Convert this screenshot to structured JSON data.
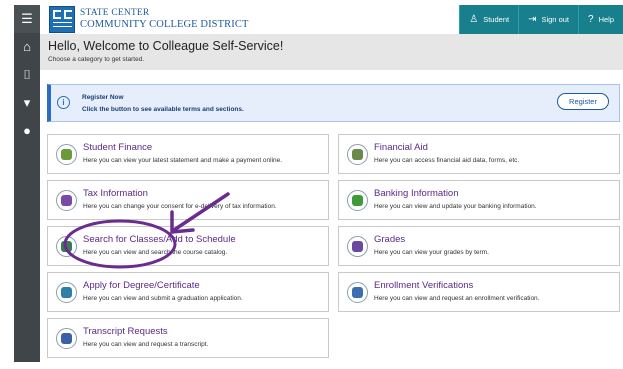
{
  "rail": {
    "items": [
      {
        "icon": "menu-icon",
        "glyph": "☰"
      },
      {
        "icon": "home-icon",
        "glyph": "⌂"
      },
      {
        "icon": "bank-icon",
        "glyph": "⌷"
      },
      {
        "icon": "graduation-cap-icon",
        "glyph": "▾"
      },
      {
        "icon": "person-icon",
        "glyph": "●"
      }
    ]
  },
  "header": {
    "school_line1": "STATE CENTER",
    "school_line2": "COMMUNITY COLLEGE DISTRICT",
    "nav": [
      {
        "label": "Student",
        "icon": "user-icon",
        "glyph": "♙"
      },
      {
        "label": "Sign out",
        "icon": "sign-out-icon",
        "glyph": "⇥"
      },
      {
        "label": "Help",
        "icon": "help-icon",
        "glyph": "?"
      }
    ],
    "accent": "#17808c"
  },
  "welcome": {
    "title": "Hello, Welcome to Colleague Self-Service!",
    "subtitle": "Choose a category to get started."
  },
  "register": {
    "title": "Register Now",
    "subtitle": "Click the button to see available terms and sections.",
    "button": "Register"
  },
  "cards": [
    {
      "title": "Student Finance",
      "desc": "Here you can view your latest statement and make a payment online.",
      "icon": "money-icon",
      "color": "#6a9a3a"
    },
    {
      "title": "Financial Aid",
      "desc": "Here you can access financial aid data, forms, etc.",
      "icon": "financial-aid-icon",
      "color": "#6b8a4a"
    },
    {
      "title": "Tax Information",
      "desc": "Here you can change your consent for e-delivery of tax information.",
      "icon": "tax-form-icon",
      "color": "#7a4aa8"
    },
    {
      "title": "Banking Information",
      "desc": "Here you can view and update your banking information.",
      "icon": "bank-transfer-icon",
      "color": "#3f9a3a"
    },
    {
      "title": "Search for Classes/Add to Schedule",
      "desc": "Here you can view and search the course catalog.",
      "icon": "course-catalog-icon",
      "color": "#3a7a50"
    },
    {
      "title": "Grades",
      "desc": "Here you can view your grades by term.",
      "icon": "grades-icon",
      "color": "#6a4aa0"
    },
    {
      "title": "Apply for Degree/Certificate",
      "desc": "Here you can view and submit a graduation application.",
      "icon": "degree-icon",
      "color": "#2f7fa8"
    },
    {
      "title": "Enrollment Verifications",
      "desc": "Here you can view and request an enrollment verification.",
      "icon": "verification-icon",
      "color": "#3c6fb0"
    },
    {
      "title": "Transcript Requests",
      "desc": "Here you can view and request a transcript.",
      "icon": "transcript-icon",
      "color": "#3a60a8"
    }
  ],
  "annotation": {
    "color": "#6b2c8f"
  }
}
